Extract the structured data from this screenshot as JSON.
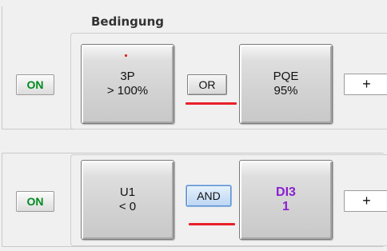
{
  "section_title": "Bedingung",
  "rows": [
    {
      "on_label": "ON",
      "left_condition": {
        "line1": "3P",
        "line2": "> 100%"
      },
      "operator": "OR",
      "right_condition": {
        "line1": "PQE",
        "line2": "95%"
      },
      "add_label": "+"
    },
    {
      "on_label": "ON",
      "left_condition": {
        "line1": "U1",
        "line2": "< 0"
      },
      "operator": "AND",
      "right_condition": {
        "line1": "DI3",
        "line2": "1"
      },
      "add_label": "+"
    }
  ],
  "colors": {
    "on_text": "#008a1e",
    "digital_input_text": "#8a1fd1",
    "underline": "#e8202a",
    "selected_operator_border": "#5a8fd0"
  }
}
